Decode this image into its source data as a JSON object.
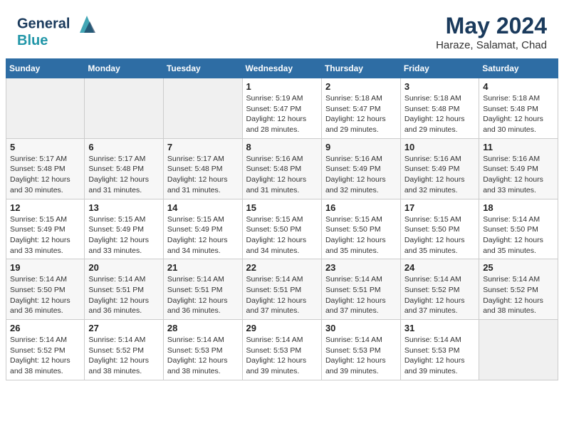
{
  "header": {
    "logo_line1": "General",
    "logo_line2": "Blue",
    "main_title": "May 2024",
    "subtitle": "Haraze, Salamat, Chad"
  },
  "days_of_week": [
    "Sunday",
    "Monday",
    "Tuesday",
    "Wednesday",
    "Thursday",
    "Friday",
    "Saturday"
  ],
  "weeks": [
    [
      {
        "day": "",
        "info": ""
      },
      {
        "day": "",
        "info": ""
      },
      {
        "day": "",
        "info": ""
      },
      {
        "day": "1",
        "info": "Sunrise: 5:19 AM\nSunset: 5:47 PM\nDaylight: 12 hours\nand 28 minutes."
      },
      {
        "day": "2",
        "info": "Sunrise: 5:18 AM\nSunset: 5:47 PM\nDaylight: 12 hours\nand 29 minutes."
      },
      {
        "day": "3",
        "info": "Sunrise: 5:18 AM\nSunset: 5:48 PM\nDaylight: 12 hours\nand 29 minutes."
      },
      {
        "day": "4",
        "info": "Sunrise: 5:18 AM\nSunset: 5:48 PM\nDaylight: 12 hours\nand 30 minutes."
      }
    ],
    [
      {
        "day": "5",
        "info": "Sunrise: 5:17 AM\nSunset: 5:48 PM\nDaylight: 12 hours\nand 30 minutes."
      },
      {
        "day": "6",
        "info": "Sunrise: 5:17 AM\nSunset: 5:48 PM\nDaylight: 12 hours\nand 31 minutes."
      },
      {
        "day": "7",
        "info": "Sunrise: 5:17 AM\nSunset: 5:48 PM\nDaylight: 12 hours\nand 31 minutes."
      },
      {
        "day": "8",
        "info": "Sunrise: 5:16 AM\nSunset: 5:48 PM\nDaylight: 12 hours\nand 31 minutes."
      },
      {
        "day": "9",
        "info": "Sunrise: 5:16 AM\nSunset: 5:49 PM\nDaylight: 12 hours\nand 32 minutes."
      },
      {
        "day": "10",
        "info": "Sunrise: 5:16 AM\nSunset: 5:49 PM\nDaylight: 12 hours\nand 32 minutes."
      },
      {
        "day": "11",
        "info": "Sunrise: 5:16 AM\nSunset: 5:49 PM\nDaylight: 12 hours\nand 33 minutes."
      }
    ],
    [
      {
        "day": "12",
        "info": "Sunrise: 5:15 AM\nSunset: 5:49 PM\nDaylight: 12 hours\nand 33 minutes."
      },
      {
        "day": "13",
        "info": "Sunrise: 5:15 AM\nSunset: 5:49 PM\nDaylight: 12 hours\nand 33 minutes."
      },
      {
        "day": "14",
        "info": "Sunrise: 5:15 AM\nSunset: 5:49 PM\nDaylight: 12 hours\nand 34 minutes."
      },
      {
        "day": "15",
        "info": "Sunrise: 5:15 AM\nSunset: 5:50 PM\nDaylight: 12 hours\nand 34 minutes."
      },
      {
        "day": "16",
        "info": "Sunrise: 5:15 AM\nSunset: 5:50 PM\nDaylight: 12 hours\nand 35 minutes."
      },
      {
        "day": "17",
        "info": "Sunrise: 5:15 AM\nSunset: 5:50 PM\nDaylight: 12 hours\nand 35 minutes."
      },
      {
        "day": "18",
        "info": "Sunrise: 5:14 AM\nSunset: 5:50 PM\nDaylight: 12 hours\nand 35 minutes."
      }
    ],
    [
      {
        "day": "19",
        "info": "Sunrise: 5:14 AM\nSunset: 5:50 PM\nDaylight: 12 hours\nand 36 minutes."
      },
      {
        "day": "20",
        "info": "Sunrise: 5:14 AM\nSunset: 5:51 PM\nDaylight: 12 hours\nand 36 minutes."
      },
      {
        "day": "21",
        "info": "Sunrise: 5:14 AM\nSunset: 5:51 PM\nDaylight: 12 hours\nand 36 minutes."
      },
      {
        "day": "22",
        "info": "Sunrise: 5:14 AM\nSunset: 5:51 PM\nDaylight: 12 hours\nand 37 minutes."
      },
      {
        "day": "23",
        "info": "Sunrise: 5:14 AM\nSunset: 5:51 PM\nDaylight: 12 hours\nand 37 minutes."
      },
      {
        "day": "24",
        "info": "Sunrise: 5:14 AM\nSunset: 5:52 PM\nDaylight: 12 hours\nand 37 minutes."
      },
      {
        "day": "25",
        "info": "Sunrise: 5:14 AM\nSunset: 5:52 PM\nDaylight: 12 hours\nand 38 minutes."
      }
    ],
    [
      {
        "day": "26",
        "info": "Sunrise: 5:14 AM\nSunset: 5:52 PM\nDaylight: 12 hours\nand 38 minutes."
      },
      {
        "day": "27",
        "info": "Sunrise: 5:14 AM\nSunset: 5:52 PM\nDaylight: 12 hours\nand 38 minutes."
      },
      {
        "day": "28",
        "info": "Sunrise: 5:14 AM\nSunset: 5:53 PM\nDaylight: 12 hours\nand 38 minutes."
      },
      {
        "day": "29",
        "info": "Sunrise: 5:14 AM\nSunset: 5:53 PM\nDaylight: 12 hours\nand 39 minutes."
      },
      {
        "day": "30",
        "info": "Sunrise: 5:14 AM\nSunset: 5:53 PM\nDaylight: 12 hours\nand 39 minutes."
      },
      {
        "day": "31",
        "info": "Sunrise: 5:14 AM\nSunset: 5:53 PM\nDaylight: 12 hours\nand 39 minutes."
      },
      {
        "day": "",
        "info": ""
      }
    ]
  ]
}
